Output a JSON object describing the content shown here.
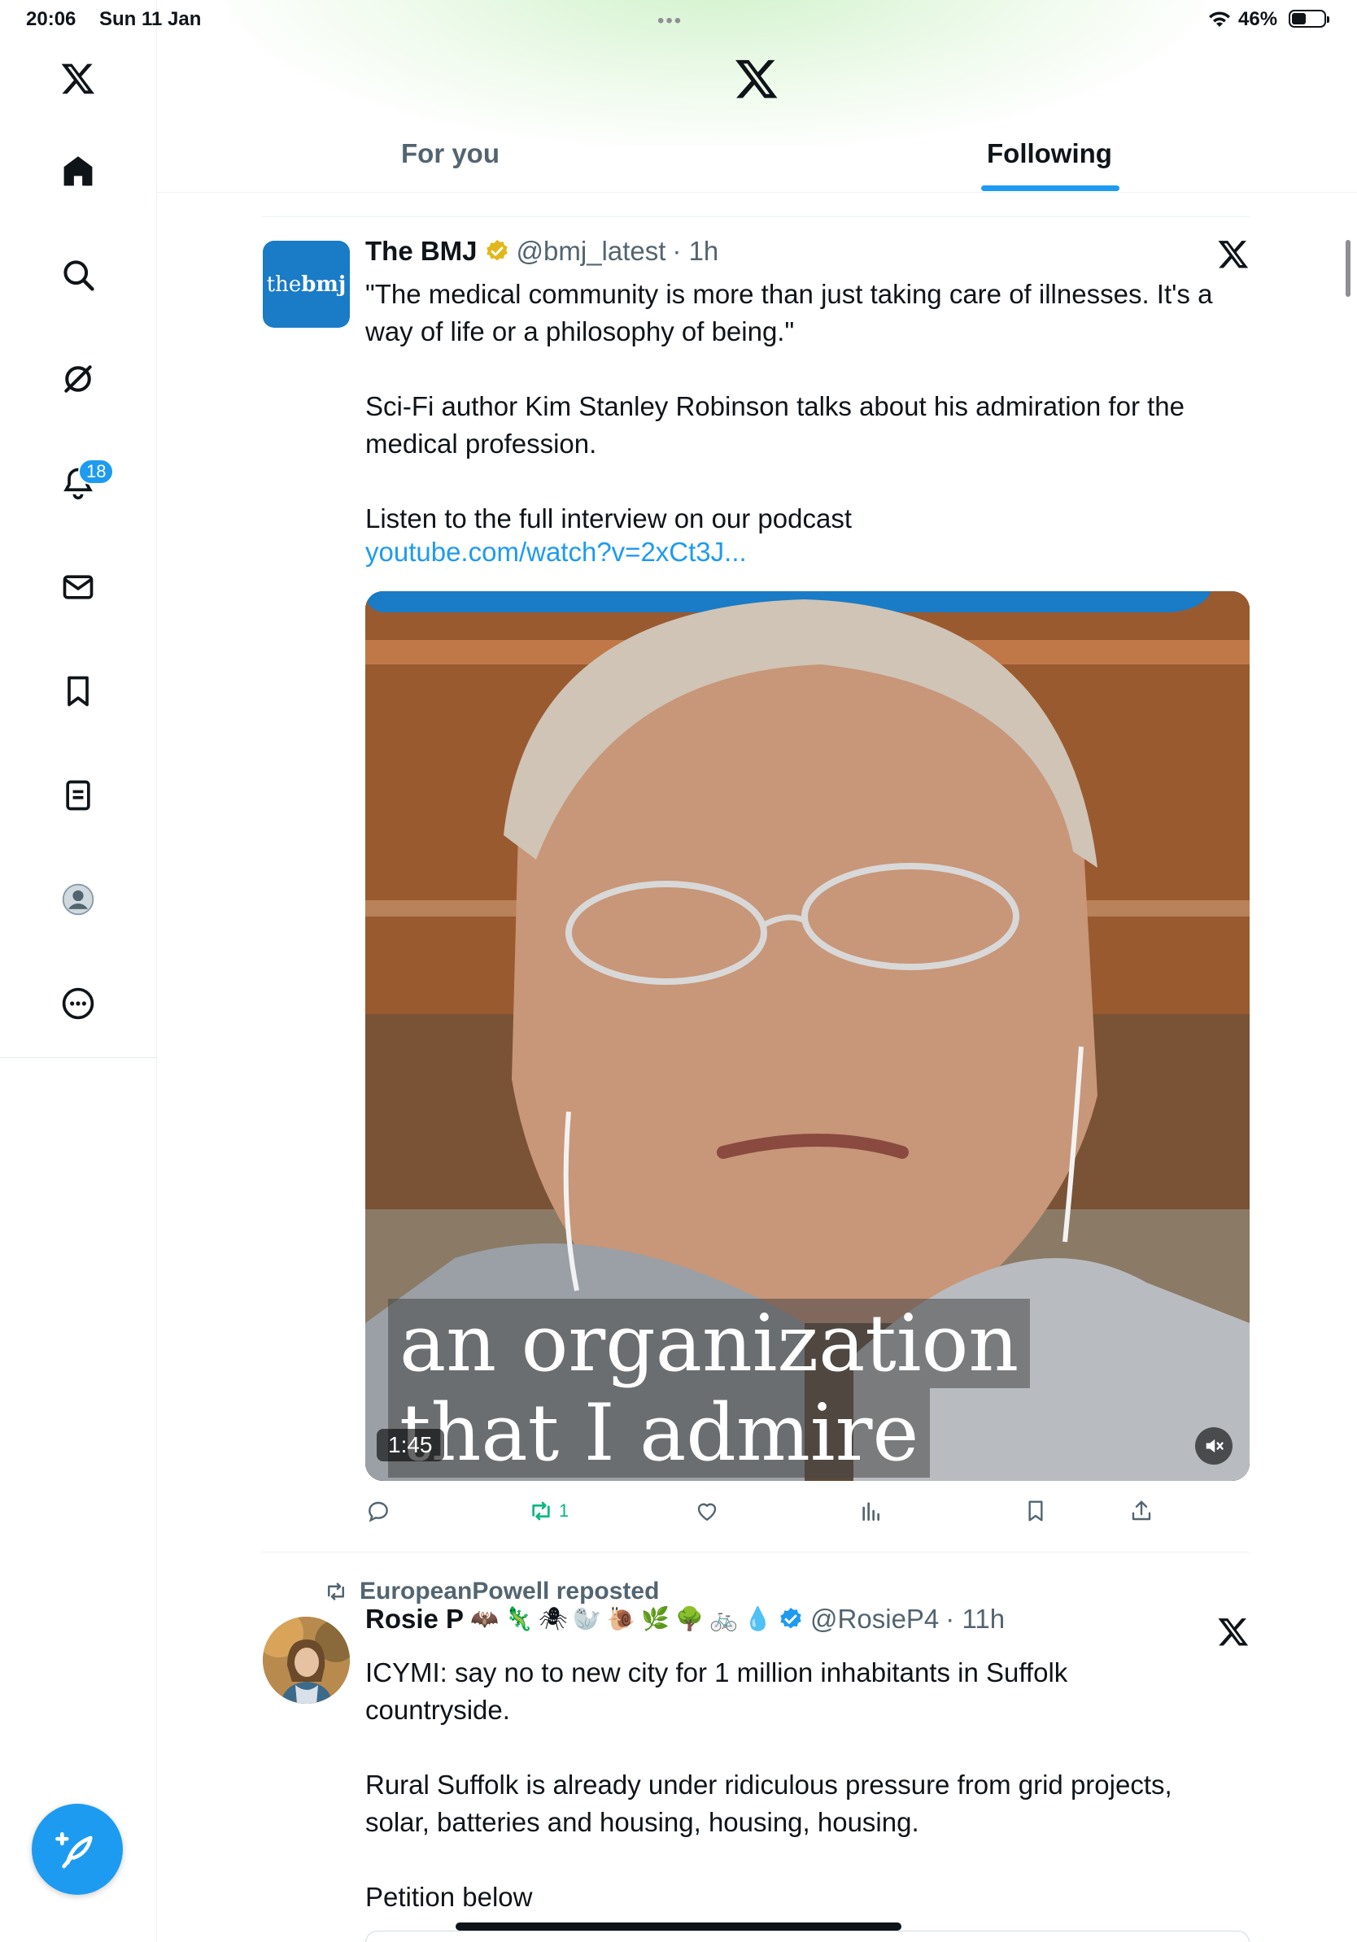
{
  "status": {
    "time": "20:06",
    "date": "Sun 11 Jan",
    "dots": "•••",
    "battery": "46%",
    "battery_level": 0.46
  },
  "sidebar": {
    "items": [
      {
        "name": "x-logo-icon",
        "label": "X"
      },
      {
        "name": "home-icon",
        "label": "Home"
      },
      {
        "name": "search-icon",
        "label": "Search"
      },
      {
        "name": "grok-icon",
        "label": "Grok"
      },
      {
        "name": "notifications-icon",
        "label": "Notifications"
      },
      {
        "name": "messages-icon",
        "label": "Messages"
      },
      {
        "name": "bookmarks-icon",
        "label": "Bookmarks"
      },
      {
        "name": "lists-icon",
        "label": "Lists"
      },
      {
        "name": "profile-icon",
        "label": "Profile"
      },
      {
        "name": "more-icon",
        "label": "More"
      }
    ],
    "notifications_badge": "18"
  },
  "header": {
    "tabs": [
      {
        "label": "For you",
        "active": false
      },
      {
        "label": "Following",
        "active": true
      }
    ]
  },
  "tweets": [
    {
      "name": "The BMJ",
      "handle": "@bmj_latest",
      "time": "· 1h",
      "avatar_text_a": "the",
      "avatar_text_b": "bmj",
      "text": "\"The medical community is more than just taking care of illnesses. It's a\nway of life or a philosophy of being.\"\n\nSci-Fi author Kim Stanley Robinson talks about his admiration for the\nmedical profession.\n\nListen to the full interview on our podcast",
      "link": "youtube.com/watch?v=2xCt3J...",
      "media": {
        "caption_line1": "an organization",
        "caption_line2": "that I admire",
        "duration": "1:45"
      },
      "actions": {
        "reposts": "1"
      }
    },
    {
      "reposted_by": "EuropeanPowell reposted",
      "name": "Rosie P",
      "emojis": [
        "🦇",
        "🦎",
        "🕷",
        "🦭",
        "🐌",
        "🌿",
        "🌳",
        "🚲",
        "💧"
      ],
      "handle": "@RosieP4",
      "time": "· 11h",
      "text": "ICYMI: say no to new city for 1 million inhabitants in Suffolk\ncountryside.\n\nRural Suffolk is already under ridiculous pressure from grid projects,\nsolar, batteries and housing, housing, housing.\n\nPetition below"
    }
  ],
  "colors": {
    "accent": "#1d9bf0",
    "repost_green": "#00ba7c",
    "secondary_text": "#536471",
    "verified_gold": "#e2b719"
  }
}
